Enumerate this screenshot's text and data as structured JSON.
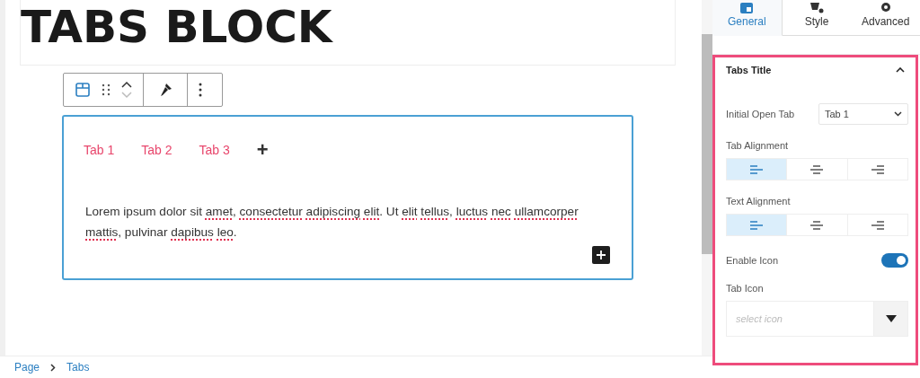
{
  "editor": {
    "heading": "TABS BLOCK",
    "toolbar": {
      "block_selected": true
    },
    "tabs_block": {
      "tabs": [
        {
          "label": "Tab 1"
        },
        {
          "label": "Tab 2"
        },
        {
          "label": "Tab 3"
        }
      ],
      "add_tab": "+",
      "content": [
        {
          "text": "Lorem",
          "misspelled": false
        },
        {
          "text": "ipsum",
          "misspelled": false
        },
        {
          "text": "dolor",
          "misspelled": false
        },
        {
          "text": "sit",
          "misspelled": false
        },
        {
          "text": "amet",
          "punct": ",",
          "misspelled": true
        },
        {
          "text": "consectetur",
          "misspelled": true
        },
        {
          "text": "adipiscing",
          "misspelled": true
        },
        {
          "text": "elit",
          "punct": ".",
          "misspelled": true
        },
        {
          "text": "Ut",
          "misspelled": false
        },
        {
          "text": "elit",
          "misspelled": true
        },
        {
          "text": "tellus",
          "punct": ",",
          "misspelled": true
        },
        {
          "text": "luctus",
          "misspelled": true
        },
        {
          "text": "nec",
          "misspelled": true
        },
        {
          "text": "ullamcorper",
          "misspelled": true
        },
        {
          "text": "mattis",
          "punct": ",",
          "misspelled": true
        },
        {
          "text": "pulvinar",
          "misspelled": false
        },
        {
          "text": "dapibus",
          "misspelled": true
        },
        {
          "text": "leo",
          "punct": ".",
          "misspelled": true
        }
      ]
    }
  },
  "breadcrumbs": [
    "Page",
    "Tabs"
  ],
  "sidebar": {
    "tabs": [
      {
        "label": "General",
        "selected": true
      },
      {
        "label": "Style",
        "selected": false
      },
      {
        "label": "Advanced",
        "selected": false
      }
    ],
    "panel": {
      "title": "Tabs Title",
      "expanded": true,
      "initial_open_tab": {
        "label": "Initial Open Tab",
        "value": "Tab 1"
      },
      "tab_alignment": {
        "label": "Tab Alignment",
        "options": [
          {
            "selected": true
          },
          {
            "selected": false
          },
          {
            "selected": false
          }
        ]
      },
      "text_alignment": {
        "label": "Text Alignment",
        "options": [
          {
            "selected": true
          },
          {
            "selected": false
          },
          {
            "selected": false
          }
        ]
      },
      "enable_icon": {
        "label": "Enable Icon",
        "on": true
      },
      "tab_icon": {
        "label": "Tab Icon",
        "placeholder": "select icon"
      }
    }
  }
}
